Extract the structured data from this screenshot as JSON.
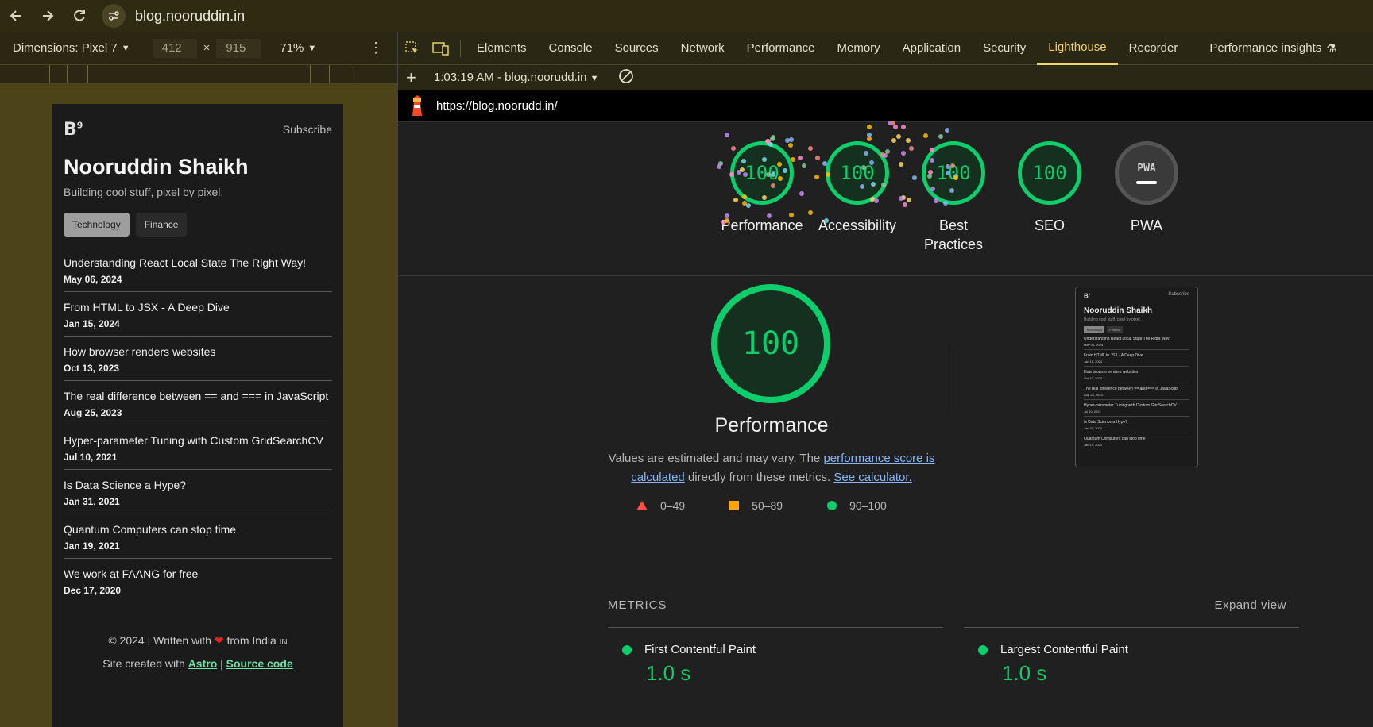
{
  "browser": {
    "url": "blog.nooruddin.in"
  },
  "device_toolbar": {
    "dimensions_label": "Dimensions: Pixel 7",
    "width": "412",
    "times": "×",
    "height": "915",
    "zoom": "71%"
  },
  "phone_page": {
    "logo": "B",
    "logo_sup": "9",
    "subscribe": "Subscribe",
    "name": "Nooruddin Shaikh",
    "tagline": "Building cool stuff, pixel by pixel.",
    "chips": [
      "Technology",
      "Finance"
    ],
    "posts": [
      {
        "title": "Understanding React Local State The Right Way!",
        "date": "May 06, 2024"
      },
      {
        "title": "From HTML to JSX - A Deep Dive",
        "date": "Jan 15, 2024"
      },
      {
        "title": "How browser renders websites",
        "date": "Oct 13, 2023"
      },
      {
        "title": "The real difference between == and === in JavaScript",
        "date": "Aug 25, 2023"
      },
      {
        "title": "Hyper-parameter Tuning with Custom GridSearchCV",
        "date": "Jul 10, 2021"
      },
      {
        "title": "Is Data Science a Hype?",
        "date": "Jan 31, 2021"
      },
      {
        "title": "Quantum Computers can stop time",
        "date": "Jan 19, 2021"
      },
      {
        "title": "We work at FAANG for free",
        "date": "Dec 17, 2020"
      }
    ],
    "footer_prefix": "© 2024 | Written with",
    "footer_heart": "❤",
    "footer_suffix": "from India",
    "footer_country": "IN",
    "footer_site": "Site created with",
    "footer_astro": "Astro",
    "footer_sep": "|",
    "footer_source": "Source code"
  },
  "devtools": {
    "tabs": [
      "Elements",
      "Console",
      "Sources",
      "Network",
      "Performance",
      "Memory",
      "Application",
      "Security",
      "Lighthouse",
      "Recorder",
      "Performance insights"
    ],
    "active_tab": "Lighthouse",
    "run_label": "1:03:19 AM - blog.noorudd.in",
    "report_url": "https://blog.noorudd.in/"
  },
  "lighthouse": {
    "categories": [
      {
        "name": "Performance",
        "score": "100"
      },
      {
        "name": "Accessibility",
        "score": "100"
      },
      {
        "name": "Best Practices",
        "score": "100"
      },
      {
        "name": "SEO",
        "score": "100"
      },
      {
        "name": "PWA",
        "score": "PWA"
      }
    ],
    "main_score": "100",
    "main_title": "Performance",
    "explain_prefix": "Values are estimated and may vary. The",
    "explain_link1": "performance score is calculated",
    "explain_mid": "directly from these metrics.",
    "explain_link2": "See calculator.",
    "legend": [
      "0–49",
      "50–89",
      "90–100"
    ],
    "metrics_title": "METRICS",
    "expand_view": "Expand view",
    "metrics": [
      {
        "name": "First Contentful Paint",
        "value": "1.0 s"
      },
      {
        "name": "Largest Contentful Paint",
        "value": "1.0 s"
      }
    ],
    "colors": {
      "pass": "#0cce6b",
      "average": "#ffa400",
      "fail": "#ff4e42"
    }
  }
}
